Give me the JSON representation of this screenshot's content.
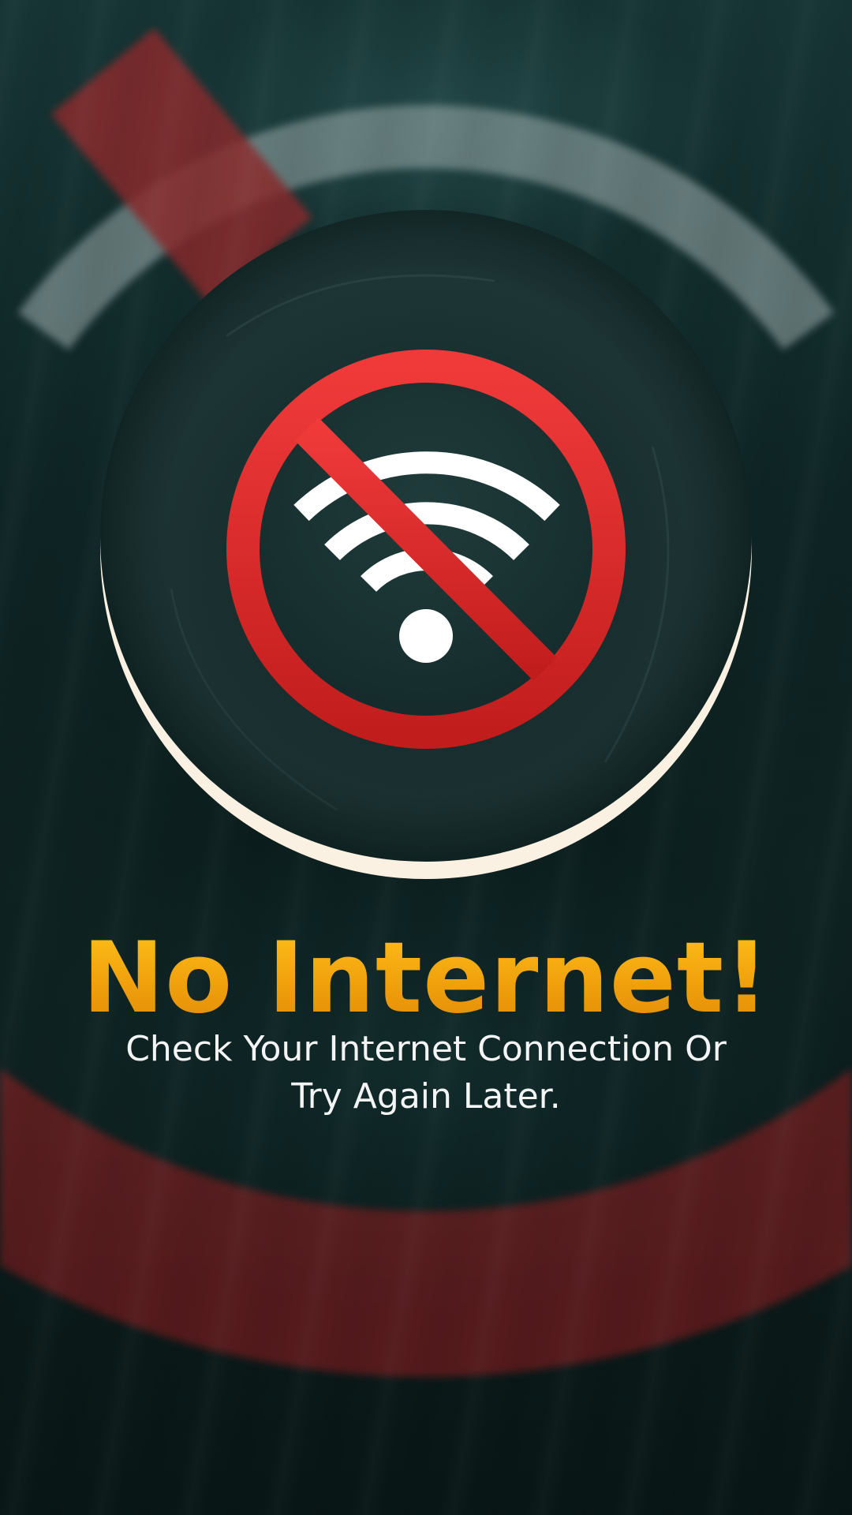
{
  "screen": {
    "title": "No Internet!",
    "message": "Check Your Internet Connection Or Try Again Later."
  },
  "icons": {
    "main": "no-wifi-icon",
    "background": "no-wifi-icon"
  },
  "colors": {
    "title": "#f2a20c",
    "message": "#f4f4f4",
    "prohibit_red": "#e32a2a",
    "wifi_white": "#ffffff",
    "disc": "#162d2d",
    "disc_rim": "#fbf1e2"
  }
}
